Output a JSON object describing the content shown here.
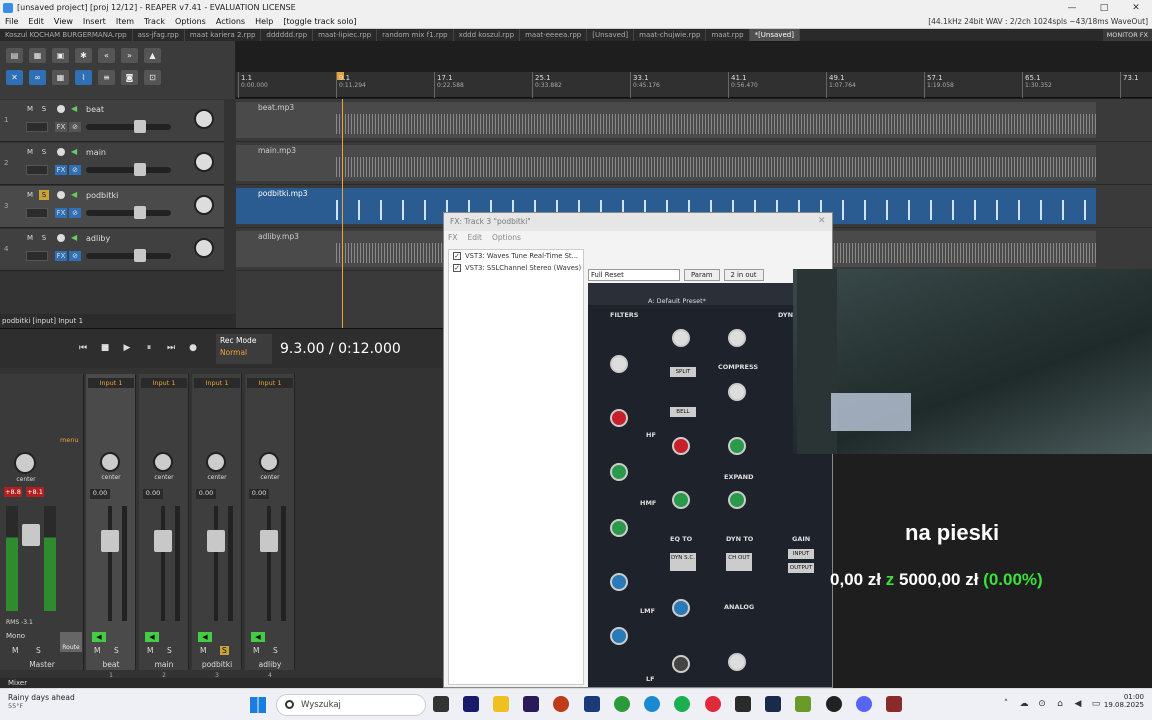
{
  "window": {
    "title": "[unsaved project] [proj 12/12] - REAPER v7.41 - EVALUATION LICENSE",
    "controls": [
      "—",
      "□",
      "✕"
    ]
  },
  "menubar": {
    "items": [
      "File",
      "Edit",
      "View",
      "Insert",
      "Item",
      "Track",
      "Options",
      "Actions",
      "Help",
      "[toggle track solo]"
    ],
    "status": "[44.1kHz 24bit WAV : 2/2ch 1024spls ~43/18ms WaveOut]"
  },
  "project_tabs": {
    "items": [
      "Koszul KOCHAM BURGERMANA.rpp",
      "ass-jfag.rpp",
      "maat kariera 2.rpp",
      "dddddd.rpp",
      "maat-lipiec.rpp",
      "random mix f1.rpp",
      "xddd koszul.rpp",
      "maat-eeeea.rpp",
      "[Unsaved]",
      "maat-chujwie.rpp",
      "maat.rpp",
      "*[Unsaved]"
    ],
    "active_index": 11,
    "monitor_fx": "MONITOR FX"
  },
  "ruler": {
    "marks": [
      {
        "bar": "1.1",
        "time": "0:00.000"
      },
      {
        "bar": "9.1",
        "time": "0:11.294"
      },
      {
        "bar": "17.1",
        "time": "0:22.588"
      },
      {
        "bar": "25.1",
        "time": "0:33.882"
      },
      {
        "bar": "33.1",
        "time": "0:45.176"
      },
      {
        "bar": "41.1",
        "time": "0:56.470"
      },
      {
        "bar": "49.1",
        "time": "1:07.764"
      },
      {
        "bar": "57.1",
        "time": "1:19.058"
      },
      {
        "bar": "65.1",
        "time": "1:30.352"
      },
      {
        "bar": "73.1",
        "time": ""
      }
    ]
  },
  "tracks": [
    {
      "num": "1",
      "name": "beat",
      "item": "beat.mp3"
    },
    {
      "num": "2",
      "name": "main",
      "item": "main.mp3"
    },
    {
      "num": "3",
      "name": "podbitki",
      "item": "podbitki.mp3"
    },
    {
      "num": "4",
      "name": "adliby",
      "item": "adliby.mp3"
    }
  ],
  "track_buttons": {
    "mute": "M",
    "solo": "S",
    "fx": "FX"
  },
  "tcp_footer": "podbitki [input] Input 1",
  "transport": {
    "rec_mode_label": "Rec Mode",
    "rec_mode_value": "Normal",
    "timecode": "9.3.00 / 0:12.000",
    "buttons": [
      "⏮",
      "■",
      "▶",
      "⏸",
      "⏭",
      "●"
    ]
  },
  "mixer": {
    "master": {
      "name": "Master",
      "pan": "center",
      "peak_l": "+8.8",
      "peak_r": "+8.1",
      "rms": "RMS",
      "rms_value": "-3.1",
      "mono": "Mono",
      "route": "Route",
      "menu": "menu"
    },
    "strips": [
      {
        "name": "beat",
        "num": "1",
        "input": "Input 1",
        "pan": "center",
        "vol": "0.00",
        "solo_on": false
      },
      {
        "name": "main",
        "num": "2",
        "input": "Input 1",
        "pan": "center",
        "vol": "0.00",
        "solo_on": false
      },
      {
        "name": "podbitki",
        "num": "3",
        "input": "Input 1",
        "pan": "center",
        "vol": "0.00",
        "solo_on": true
      },
      {
        "name": "adliby",
        "num": "4",
        "input": "Input 1",
        "pan": "center",
        "vol": "0.00",
        "solo_on": false
      }
    ],
    "footer": "Mixer"
  },
  "fx_window": {
    "title": "FX: Track 3 \"podbitki\"",
    "menu": [
      "FX",
      "Edit",
      "Options"
    ],
    "chain": [
      {
        "label": "VST3: Waves Tune Real-Time St...",
        "enabled": true
      },
      {
        "label": "VST3: SSLChannel Stereo (Waves)",
        "enabled": true
      }
    ],
    "preset": "Full Reset",
    "param_btn": "Param",
    "io_btn": "2 in out",
    "plugin": {
      "preset_name": "A: Default Preset*",
      "sections": [
        "FILTERS",
        "DYN",
        "COMPRESS",
        "EXPAND",
        "HF",
        "HMF",
        "LMF",
        "LF",
        "EQ TO",
        "DYN TO",
        "ANALOG",
        "GAIN"
      ],
      "buttons": [
        "SPLIT",
        "BELL",
        "DYN S.C.",
        "CH OUT",
        "INPUT",
        "OUTPUT"
      ]
    }
  },
  "overlay": {
    "title": "na pieski",
    "raised": "0,00 zł",
    "of": "z",
    "goal": "5000,00 zł",
    "percent": "(0.00%)"
  },
  "taskbar": {
    "weather_text": "Rainy days ahead",
    "weather_temp": "55°F",
    "search_placeholder": "Wyszukaj",
    "time": "01:00",
    "date": "19.08.2025"
  }
}
